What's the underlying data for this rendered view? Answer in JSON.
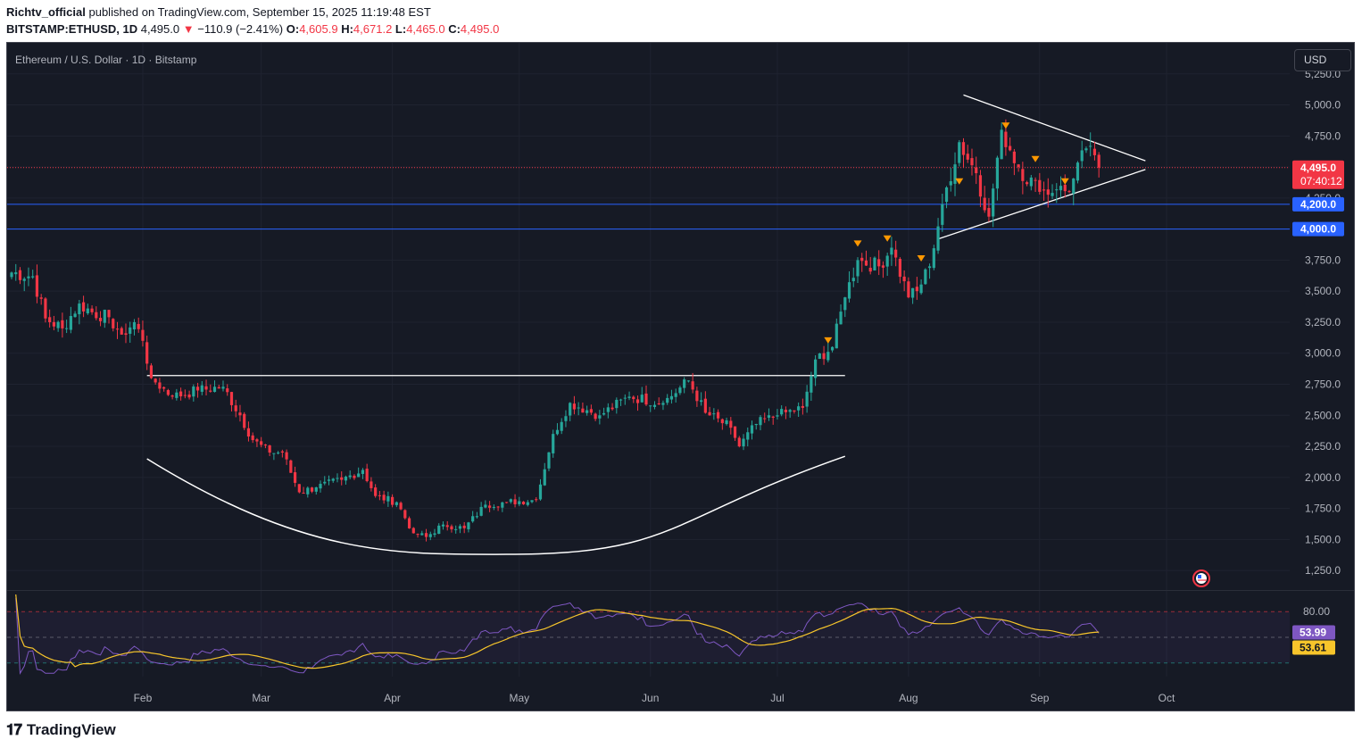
{
  "header": {
    "author": "Richtv_official",
    "published_text": "published on TradingView.com, September 15, 2025 11:19:48 EST",
    "symbol": "BITSTAMP:ETHUSD, 1D",
    "last": "4,495.0",
    "change_arrow": "▼",
    "change": "−110.9 (−2.41%)",
    "o_label": "O:",
    "o_value": "4,605.9",
    "h_label": "H:",
    "h_value": "4,671.2",
    "l_label": "L:",
    "l_value": "4,465.0",
    "c_label": "C:",
    "c_value": "4,495.0"
  },
  "chart_title": "Ethereum / U.S. Dollar · 1D · Bitstamp",
  "currency_button": "USD",
  "footer": {
    "logo_icon": "tradingview-logo-icon",
    "brand": "TradingView"
  },
  "colors": {
    "background": "#161a25",
    "up": "#26a69a",
    "down": "#f23645",
    "level_line": "#2962ff",
    "rsi_line": "#7e57c2",
    "rsi_ma": "#f7c52b",
    "marker": "#ff9800"
  },
  "chart_data": {
    "type": "candlestick",
    "x_labels": [
      "Feb",
      "Mar",
      "Apr",
      "May",
      "Jun",
      "Jul",
      "Aug",
      "Sep",
      "Oct"
    ],
    "y_ticks": [
      "5,250.0",
      "5,000.0",
      "4,750.0",
      "4,500.0",
      "4,250.0",
      "4,000.0",
      "3,750.0",
      "3,500.0",
      "3,250.0",
      "3,000.0",
      "2,750.0",
      "2,500.0",
      "2,250.0",
      "2,000.0",
      "1,750.0",
      "1,500.0",
      "1,250.0"
    ],
    "ylim": [
      1100,
      5500
    ],
    "price_labels": {
      "last_price": "4,495.0",
      "countdown": "07:40:12",
      "level_1": "4,200.0",
      "level_2": "4,000.0"
    },
    "horizontal_levels": [
      4200,
      4000
    ],
    "close_series": [
      {
        "date": "2025-01-01",
        "close": 3650
      },
      {
        "date": "2025-01-06",
        "close": 3620
      },
      {
        "date": "2025-01-09",
        "close": 3280
      },
      {
        "date": "2025-01-13",
        "close": 3200
      },
      {
        "date": "2025-01-17",
        "close": 3400
      },
      {
        "date": "2025-01-20",
        "close": 3330
      },
      {
        "date": "2025-01-24",
        "close": 3290
      },
      {
        "date": "2025-01-27",
        "close": 3150
      },
      {
        "date": "2025-01-30",
        "close": 3250
      },
      {
        "date": "2025-02-01",
        "close": 3100
      },
      {
        "date": "2025-02-03",
        "close": 2800
      },
      {
        "date": "2025-02-08",
        "close": 2650
      },
      {
        "date": "2025-02-14",
        "close": 2700
      },
      {
        "date": "2025-02-20",
        "close": 2730
      },
      {
        "date": "2025-02-24",
        "close": 2500
      },
      {
        "date": "2025-02-27",
        "close": 2300
      },
      {
        "date": "2025-03-03",
        "close": 2200
      },
      {
        "date": "2025-03-06",
        "close": 2200
      },
      {
        "date": "2025-03-10",
        "close": 1880
      },
      {
        "date": "2025-03-14",
        "close": 1920
      },
      {
        "date": "2025-03-20",
        "close": 1980
      },
      {
        "date": "2025-03-25",
        "close": 2060
      },
      {
        "date": "2025-03-28",
        "close": 1850
      },
      {
        "date": "2025-04-02",
        "close": 1800
      },
      {
        "date": "2025-04-06",
        "close": 1550
      },
      {
        "date": "2025-04-09",
        "close": 1520
      },
      {
        "date": "2025-04-13",
        "close": 1620
      },
      {
        "date": "2025-04-18",
        "close": 1590
      },
      {
        "date": "2025-04-23",
        "close": 1780
      },
      {
        "date": "2025-04-28",
        "close": 1800
      },
      {
        "date": "2025-05-05",
        "close": 1820
      },
      {
        "date": "2025-05-09",
        "close": 2350
      },
      {
        "date": "2025-05-13",
        "close": 2600
      },
      {
        "date": "2025-05-20",
        "close": 2500
      },
      {
        "date": "2025-05-27",
        "close": 2650
      },
      {
        "date": "2025-06-04",
        "close": 2600
      },
      {
        "date": "2025-06-10",
        "close": 2780
      },
      {
        "date": "2025-06-14",
        "close": 2520
      },
      {
        "date": "2025-06-20",
        "close": 2400
      },
      {
        "date": "2025-06-22",
        "close": 2250
      },
      {
        "date": "2025-06-26",
        "close": 2430
      },
      {
        "date": "2025-07-01",
        "close": 2500
      },
      {
        "date": "2025-07-07",
        "close": 2560
      },
      {
        "date": "2025-07-10",
        "close": 2950
      },
      {
        "date": "2025-07-14",
        "close": 3050
      },
      {
        "date": "2025-07-17",
        "close": 3450
      },
      {
        "date": "2025-07-20",
        "close": 3750
      },
      {
        "date": "2025-07-25",
        "close": 3700
      },
      {
        "date": "2025-07-28",
        "close": 3850
      },
      {
        "date": "2025-08-01",
        "close": 3450
      },
      {
        "date": "2025-08-03",
        "close": 3500
      },
      {
        "date": "2025-08-06",
        "close": 3700
      },
      {
        "date": "2025-08-09",
        "close": 4200
      },
      {
        "date": "2025-08-13",
        "close": 4700
      },
      {
        "date": "2025-08-17",
        "close": 4450
      },
      {
        "date": "2025-08-20",
        "close": 4100
      },
      {
        "date": "2025-08-23",
        "close": 4800
      },
      {
        "date": "2025-08-27",
        "close": 4500
      },
      {
        "date": "2025-09-01",
        "close": 4300
      },
      {
        "date": "2025-09-05",
        "close": 4320
      },
      {
        "date": "2025-09-08",
        "close": 4300
      },
      {
        "date": "2025-09-12",
        "close": 4650
      },
      {
        "date": "2025-09-15",
        "close": 4495
      }
    ],
    "drawings": {
      "resistance_line": {
        "from": {
          "date": "2025-02-02",
          "price": 2820
        },
        "to": {
          "date": "2025-07-17",
          "price": 2820
        }
      },
      "rounded_bottom": {
        "start": {
          "date": "2025-02-02",
          "price": 2150
        },
        "bottom": {
          "date": "2025-04-28",
          "price": 1380
        },
        "end": {
          "date": "2025-07-17",
          "price": 2170
        }
      },
      "triangle_upper": {
        "from": {
          "date": "2025-08-14",
          "price": 5080
        },
        "to": {
          "date": "2025-09-26",
          "price": 4550
        }
      },
      "triangle_lower": {
        "from": {
          "date": "2025-08-08",
          "price": 3920
        },
        "to": {
          "date": "2025-09-26",
          "price": 4480
        }
      },
      "markers": [
        {
          "date": "2025-07-13",
          "price": 3100
        },
        {
          "date": "2025-07-20",
          "price": 3880
        },
        {
          "date": "2025-07-27",
          "price": 3920
        },
        {
          "date": "2025-08-04",
          "price": 3760
        },
        {
          "date": "2025-08-13",
          "price": 4380
        },
        {
          "date": "2025-08-24",
          "price": 4830
        },
        {
          "date": "2025-08-31",
          "price": 4560
        },
        {
          "date": "2025-09-07",
          "price": 4380
        }
      ]
    },
    "rsi": {
      "ticks": [
        "80.00"
      ],
      "value_label": "53.99",
      "ma_label": "53.61",
      "line_color": "#7e57c2",
      "ma_color": "#f7c52b"
    }
  }
}
